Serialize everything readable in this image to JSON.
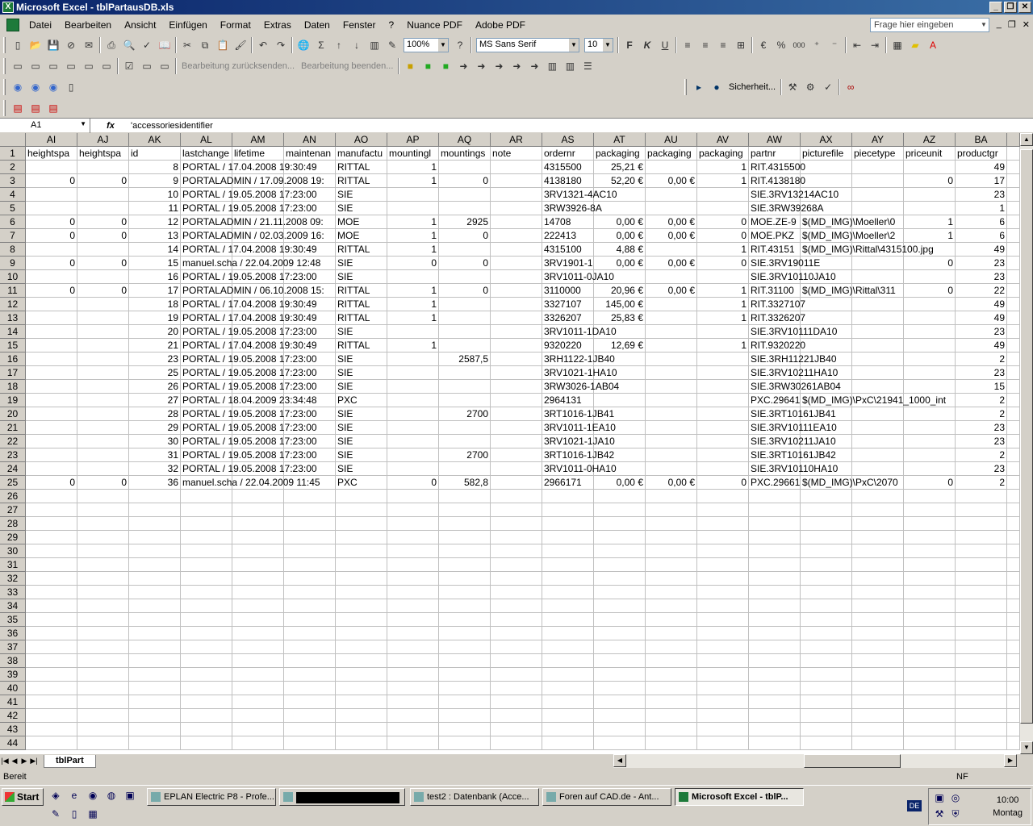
{
  "window": {
    "title": "Microsoft Excel - tblPartausDB.xls"
  },
  "menu": [
    "Datei",
    "Bearbeiten",
    "Ansicht",
    "Einfügen",
    "Format",
    "Extras",
    "Daten",
    "Fenster",
    "?",
    "Nuance PDF",
    "Adobe PDF"
  ],
  "help_placeholder": "Frage hier eingeben",
  "toolbar": {
    "zoom": "100%",
    "font": "MS Sans Serif",
    "size": "10",
    "bold": "F",
    "italic": "K",
    "underline": "U",
    "percent": "%",
    "thousands": "000",
    "review_send": "Bearbeitung zurücksenden...",
    "review_end": "Bearbeitung beenden...",
    "security": "Sicherheit..."
  },
  "formula": {
    "name_box": "A1",
    "fx": "fx",
    "value": "'accessoriesidentifier"
  },
  "columns": [
    "AI",
    "AJ",
    "AK",
    "AL",
    "AM",
    "AN",
    "AO",
    "AP",
    "AQ",
    "AR",
    "AS",
    "AT",
    "AU",
    "AV",
    "AW",
    "AX",
    "AY",
    "AZ",
    "BA"
  ],
  "rows": [
    [
      "heightspa",
      "heightspa",
      "id",
      "lastchange",
      "lifetime",
      "maintenan",
      "manufactu",
      "mountingl",
      "mountings",
      "note",
      "ordernr",
      "packaging",
      "packaging",
      "packaging",
      "partnr",
      "picturefile",
      "piecetype",
      "priceunit",
      "productgr"
    ],
    [
      "",
      "",
      "8",
      "PORTAL / 17.04.2008 19:30:49",
      "",
      "",
      "RITTAL",
      "1",
      "",
      "",
      "4315500",
      "25,21 €",
      "",
      "1",
      "RIT.4315500",
      "",
      "",
      "",
      "49"
    ],
    [
      "0",
      "0",
      "9",
      "PORTALADMIN / 17.09.2008 19:",
      "",
      "",
      "RITTAL",
      "1",
      "0",
      "",
      "4138180",
      "52,20 €",
      "0,00 €",
      "1",
      "RIT.4138180",
      "",
      "",
      "0",
      "17"
    ],
    [
      "",
      "",
      "10",
      "PORTAL / 19.05.2008 17:23:00",
      "",
      "",
      "SIE",
      "",
      "",
      "",
      "3RV1321-4AC10",
      "",
      "",
      "",
      "SIE.3RV13214AC10",
      "",
      "",
      "",
      "23"
    ],
    [
      "",
      "",
      "11",
      "PORTAL / 19.05.2008 17:23:00",
      "",
      "",
      "SIE",
      "",
      "",
      "",
      "3RW3926-8A",
      "",
      "",
      "",
      "SIE.3RW39268A",
      "",
      "",
      "",
      "1"
    ],
    [
      "0",
      "0",
      "12",
      "PORTALADMIN / 21.11.2008 09:",
      "",
      "",
      "MOE",
      "1",
      "2925",
      "",
      "14708",
      "0,00 €",
      "0,00 €",
      "0",
      "MOE.ZE-9",
      "$(MD_IMG)\\Moeller\\0",
      "",
      "1",
      "6"
    ],
    [
      "0",
      "0",
      "13",
      "PORTALADMIN / 02.03.2009 16:",
      "",
      "",
      "MOE",
      "1",
      "0",
      "",
      "222413",
      "0,00 €",
      "0,00 €",
      "0",
      "MOE.PKZ",
      "$(MD_IMG)\\Moeller\\2",
      "",
      "1",
      "6"
    ],
    [
      "",
      "",
      "14",
      "PORTAL / 17.04.2008 19:30:49",
      "",
      "",
      "RITTAL",
      "1",
      "",
      "",
      "4315100",
      "4,88 €",
      "",
      "1",
      "RIT.43151",
      "$(MD_IMG)\\Rittal\\4315100.jpg",
      "",
      "",
      "49"
    ],
    [
      "0",
      "0",
      "15",
      "manuel.scha / 22.04.2009 12:48",
      "",
      "",
      "SIE",
      "0",
      "0",
      "",
      "3RV1901-1",
      "0,00 €",
      "0,00 €",
      "0",
      "SIE.3RV19011E",
      "",
      "",
      "0",
      "23"
    ],
    [
      "",
      "",
      "16",
      "PORTAL / 19.05.2008 17:23:00",
      "",
      "",
      "SIE",
      "",
      "",
      "",
      "3RV1011-0JA10",
      "",
      "",
      "",
      "SIE.3RV10110JA10",
      "",
      "",
      "",
      "23"
    ],
    [
      "0",
      "0",
      "17",
      "PORTALADMIN / 06.10.2008 15:",
      "",
      "",
      "RITTAL",
      "1",
      "0",
      "",
      "3110000",
      "20,96 €",
      "0,00 €",
      "1",
      "RIT.31100",
      "$(MD_IMG)\\Rittal\\311",
      "",
      "0",
      "22"
    ],
    [
      "",
      "",
      "18",
      "PORTAL / 17.04.2008 19:30:49",
      "",
      "",
      "RITTAL",
      "1",
      "",
      "",
      "3327107",
      "145,00 €",
      "",
      "1",
      "RIT.3327107",
      "",
      "",
      "",
      "49"
    ],
    [
      "",
      "",
      "19",
      "PORTAL / 17.04.2008 19:30:49",
      "",
      "",
      "RITTAL",
      "1",
      "",
      "",
      "3326207",
      "25,83 €",
      "",
      "1",
      "RIT.3326207",
      "",
      "",
      "",
      "49"
    ],
    [
      "",
      "",
      "20",
      "PORTAL / 19.05.2008 17:23:00",
      "",
      "",
      "SIE",
      "",
      "",
      "",
      "3RV1011-1DA10",
      "",
      "",
      "",
      "SIE.3RV10111DA10",
      "",
      "",
      "",
      "23"
    ],
    [
      "",
      "",
      "21",
      "PORTAL / 17.04.2008 19:30:49",
      "",
      "",
      "RITTAL",
      "1",
      "",
      "",
      "9320220",
      "12,69 €",
      "",
      "1",
      "RIT.9320220",
      "",
      "",
      "",
      "49"
    ],
    [
      "",
      "",
      "23",
      "PORTAL / 19.05.2008 17:23:00",
      "",
      "",
      "SIE",
      "",
      "2587,5",
      "",
      "3RH1122-1JB40",
      "",
      "",
      "",
      "SIE.3RH11221JB40",
      "",
      "",
      "",
      "2"
    ],
    [
      "",
      "",
      "25",
      "PORTAL / 19.05.2008 17:23:00",
      "",
      "",
      "SIE",
      "",
      "",
      "",
      "3RV1021-1HA10",
      "",
      "",
      "",
      "SIE.3RV10211HA10",
      "",
      "",
      "",
      "23"
    ],
    [
      "",
      "",
      "26",
      "PORTAL / 19.05.2008 17:23:00",
      "",
      "",
      "SIE",
      "",
      "",
      "",
      "3RW3026-1AB04",
      "",
      "",
      "",
      "SIE.3RW30261AB04",
      "",
      "",
      "",
      "15"
    ],
    [
      "",
      "",
      "27",
      "PORTAL / 18.04.2009 23:34:48",
      "",
      "",
      "PXC",
      "",
      "",
      "",
      "2964131",
      "",
      "",
      "",
      "PXC.29641",
      "$(MD_IMG)\\PxC\\21941_1000_int",
      "",
      "",
      "2"
    ],
    [
      "",
      "",
      "28",
      "PORTAL / 19.05.2008 17:23:00",
      "",
      "",
      "SIE",
      "",
      "2700",
      "",
      "3RT1016-1JB41",
      "",
      "",
      "",
      "SIE.3RT10161JB41",
      "",
      "",
      "",
      "2"
    ],
    [
      "",
      "",
      "29",
      "PORTAL / 19.05.2008 17:23:00",
      "",
      "",
      "SIE",
      "",
      "",
      "",
      "3RV1011-1EA10",
      "",
      "",
      "",
      "SIE.3RV10111EA10",
      "",
      "",
      "",
      "23"
    ],
    [
      "",
      "",
      "30",
      "PORTAL / 19.05.2008 17:23:00",
      "",
      "",
      "SIE",
      "",
      "",
      "",
      "3RV1021-1JA10",
      "",
      "",
      "",
      "SIE.3RV10211JA10",
      "",
      "",
      "",
      "23"
    ],
    [
      "",
      "",
      "31",
      "PORTAL / 19.05.2008 17:23:00",
      "",
      "",
      "SIE",
      "",
      "2700",
      "",
      "3RT1016-1JB42",
      "",
      "",
      "",
      "SIE.3RT10161JB42",
      "",
      "",
      "",
      "2"
    ],
    [
      "",
      "",
      "32",
      "PORTAL / 19.05.2008 17:23:00",
      "",
      "",
      "SIE",
      "",
      "",
      "",
      "3RV1011-0HA10",
      "",
      "",
      "",
      "SIE.3RV10110HA10",
      "",
      "",
      "",
      "23"
    ],
    [
      "0",
      "0",
      "36",
      "manuel.scha / 22.04.2009 11:45",
      "",
      "",
      "PXC",
      "0",
      "582,8",
      "",
      "2966171",
      "0,00 €",
      "0,00 €",
      "0",
      "PXC.29661",
      "$(MD_IMG)\\PxC\\2070",
      "",
      "0",
      "2"
    ]
  ],
  "row_count": 44,
  "sheet_tab": "tblPart",
  "status": {
    "left": "Bereit",
    "right": "NF"
  },
  "taskbar": {
    "start": "Start",
    "tasks": [
      "EPLAN Electric P8 - Profe...",
      "",
      "test2 : Datenbank (Acce...",
      "Foren auf CAD.de - Ant...",
      "Microsoft Excel - tblP..."
    ],
    "lang": "DE",
    "time": "10:00",
    "day": "Montag"
  }
}
